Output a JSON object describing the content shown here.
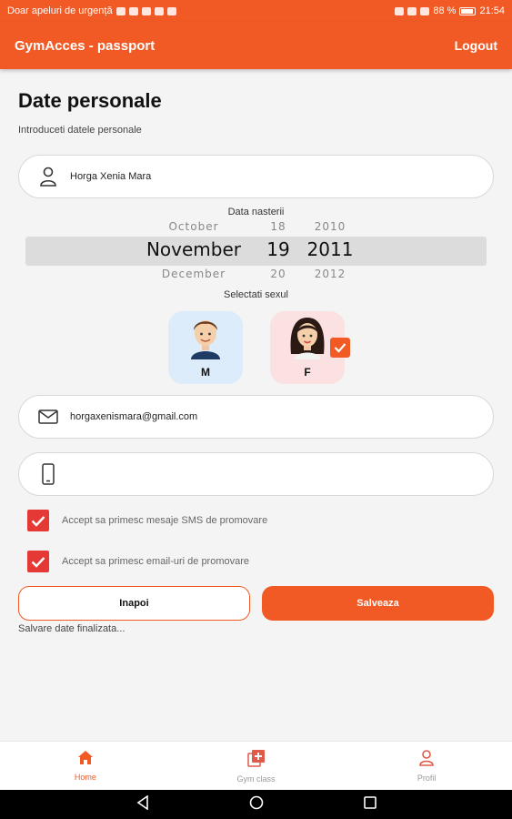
{
  "status_bar": {
    "carrier_text": "Doar apeluri de urgență",
    "battery": "88 %",
    "time": "21:54"
  },
  "app_bar": {
    "title": "GymAcces - passport",
    "logout_label": "Logout"
  },
  "form": {
    "title": "Date personale",
    "subtitle": "Introduceti datele personale",
    "name_value": "Horga Xenia Mara",
    "dob": {
      "label": "Data nasterii",
      "month": {
        "prev": "October",
        "current": "November",
        "next": "December"
      },
      "day": {
        "prev": "18",
        "current": "19",
        "next": "20"
      },
      "year": {
        "prev": "2010",
        "current": "2011",
        "next": "2012"
      }
    },
    "sex": {
      "label": "Selectati sexul",
      "male_letter": "M",
      "female_letter": "F",
      "selected": "F"
    },
    "email_value": "horgaxenismara@gmail.com",
    "phone_value": "",
    "checkboxes": [
      {
        "label": "Accept sa primesc mesaje SMS de promovare",
        "checked": true
      },
      {
        "label": "Accept sa primesc email-uri de promovare",
        "checked": true
      }
    ],
    "back_label": "Inapoi",
    "save_label": "Salveaza",
    "save_status": "Salvare date finalizata..."
  },
  "bottom_nav": [
    {
      "label": "Home",
      "icon": "home-icon",
      "active": true
    },
    {
      "label": "Gym class",
      "icon": "gym-class-icon",
      "active": false
    },
    {
      "label": "Profil",
      "icon": "profile-icon",
      "active": false
    }
  ],
  "colors": {
    "accent": "#f15a24",
    "checkbox": "#e53935",
    "male_bg": "#dcecfa",
    "female_bg": "#fbe1e1"
  }
}
